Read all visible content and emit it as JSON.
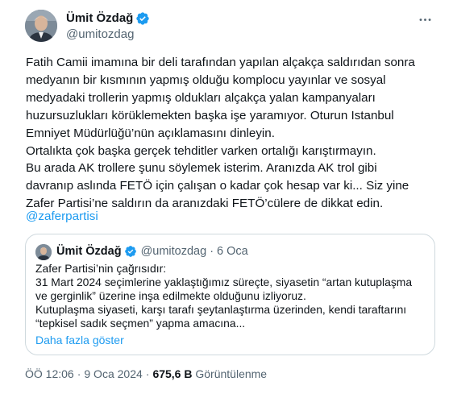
{
  "tweet": {
    "author": {
      "display_name": "Ümit Özdağ",
      "handle": "@umitozdag",
      "verified": true,
      "avatar_icon": "avatar-photo"
    },
    "more_icon": "more-options-icon",
    "body_lines": [
      "Fatih Camii imamına bir deli tarafından yapılan alçakça saldırıdan sonra",
      "medyanın bir kısmının yapmış olduğu komplocu yayınlar ve sosyal",
      "medyadaki trollerin yapmış oldukları alçakça yalan kampanyaları",
      "huzursuzlukları körüklemekten başka işe yaramıyor. Oturun Istanbul",
      "Emniyet Müdürlüğü’nün açıklamasını dinleyin.",
      "Ortalıkta çok başka gerçek tehditler varken ortalığı karıştırmayın.",
      "Bu arada AK trollere şunu söylemek isterim. Aranızda AK trol gibi",
      "davranıp aslında FETÖ için çalışan o kadar çok hesap var ki... Siz yine",
      "Zafer Partisi’ne saldırın da aranızdaki FETÖ’cülere de dikkat edin."
    ],
    "mention": "@zaferpartisi",
    "quoted": {
      "display_name": "Ümit Özdağ",
      "handle": "@umitozdag",
      "separator": "·",
      "date": "6 Oca",
      "body_lines": [
        "Zafer Partisi’nin çağrısıdır:",
        "31 Mart 2024 seçimlerine yaklaştığımız süreçte, siyasetin “artan kutuplaşma",
        "ve gerginlik” üzerine inşa edilmekte olduğunu izliyoruz.",
        "Kutuplaşma siyaseti, karşı tarafı şeytanlaştırma üzerinden, kendi taraftarını",
        "“tepkisel sadık seçmen” yapma amacına..."
      ],
      "show_more": "Daha fazla göster"
    },
    "meta": {
      "time": "ÖÖ 12:06",
      "separator": "·",
      "date": "9 Oca 2024",
      "views_count": "675,6 B",
      "views_label": "Görüntülenme"
    },
    "colors": {
      "accent": "#1d9bf0",
      "secondary_text": "#536471",
      "primary_text": "#0f1419",
      "border": "#cfd9de"
    }
  }
}
